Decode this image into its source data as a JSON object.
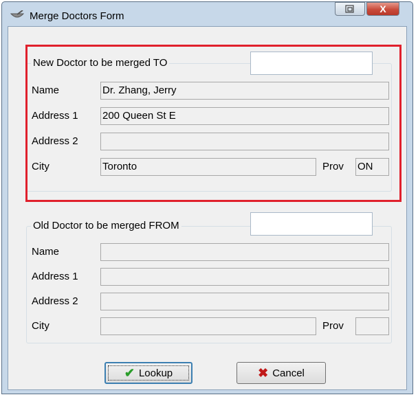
{
  "window": {
    "title": "Merge Doctors Form",
    "close_symbol": "X"
  },
  "new_doctor": {
    "legend": "New Doctor to be merged TO",
    "lookup_value": "",
    "labels": {
      "name": "Name",
      "address1": "Address 1",
      "address2": "Address 2",
      "city": "City",
      "prov": "Prov"
    },
    "values": {
      "name": "Dr. Zhang, Jerry",
      "address1": "200 Queen St E",
      "address2": "",
      "city": "Toronto",
      "prov": "ON"
    }
  },
  "old_doctor": {
    "legend": "Old Doctor to be merged FROM",
    "lookup_value": "",
    "labels": {
      "name": "Name",
      "address1": "Address 1",
      "address2": "Address 2",
      "city": "City",
      "prov": "Prov"
    },
    "values": {
      "name": "",
      "address1": "",
      "address2": "",
      "city": "",
      "prov": ""
    }
  },
  "buttons": {
    "lookup": "Lookup",
    "cancel": "Cancel"
  },
  "colors": {
    "highlight": "#e0202c",
    "check": "#2a9d2a",
    "cancel_x": "#c01818"
  }
}
